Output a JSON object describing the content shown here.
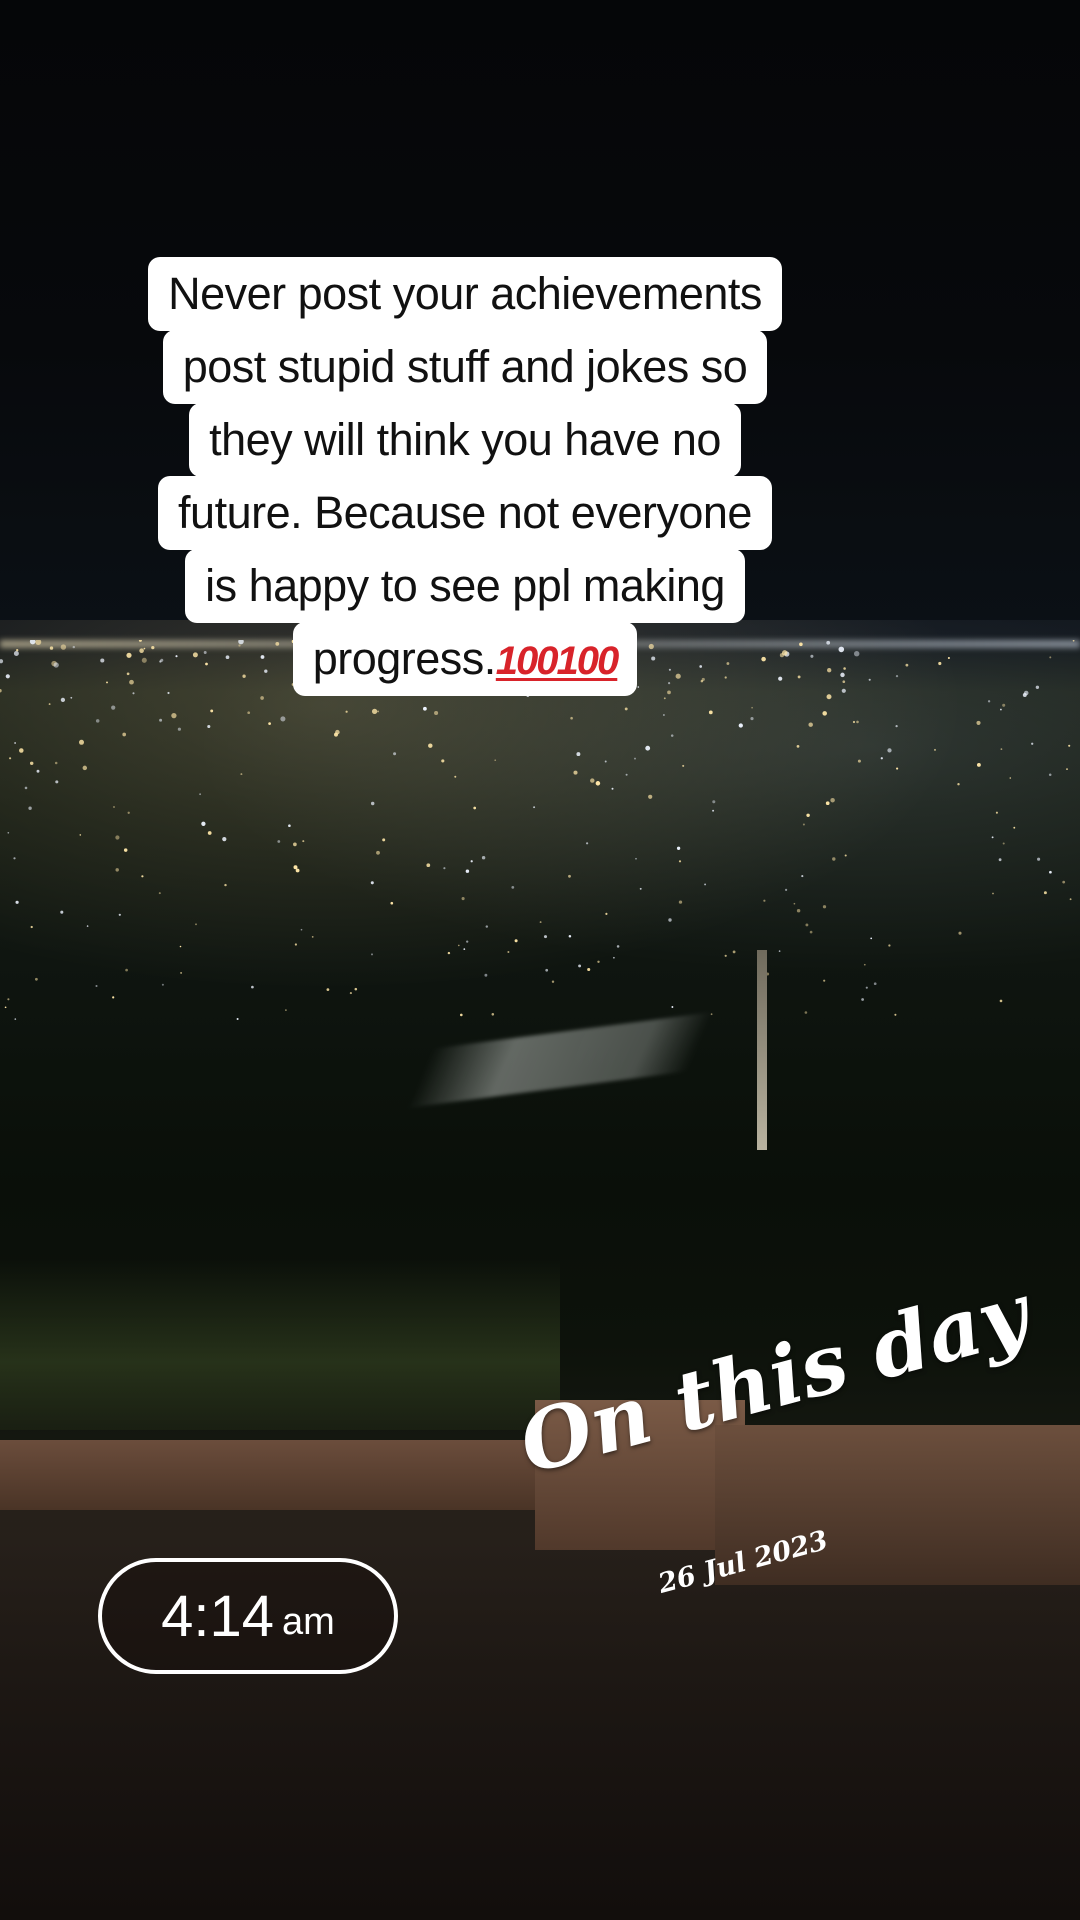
{
  "caption": {
    "lines": [
      "Never post your achievements",
      "post stupid stuff and jokes so",
      "they will think you have no",
      "future. Because not everyone",
      "is happy to see ppl making"
    ],
    "last_line_text": "progress.",
    "last_line_emoji": "💯💯",
    "last_line_emoji_fallback": "100100"
  },
  "time_sticker": {
    "time": "4:14",
    "period": "am"
  },
  "memory_sticker": {
    "title": "On this day",
    "date": "26 Jul 2023"
  },
  "colors": {
    "caption_bg": "#ffffff",
    "caption_text": "#111111",
    "emoji_red": "#d8232a",
    "sticker_white": "#ffffff"
  }
}
